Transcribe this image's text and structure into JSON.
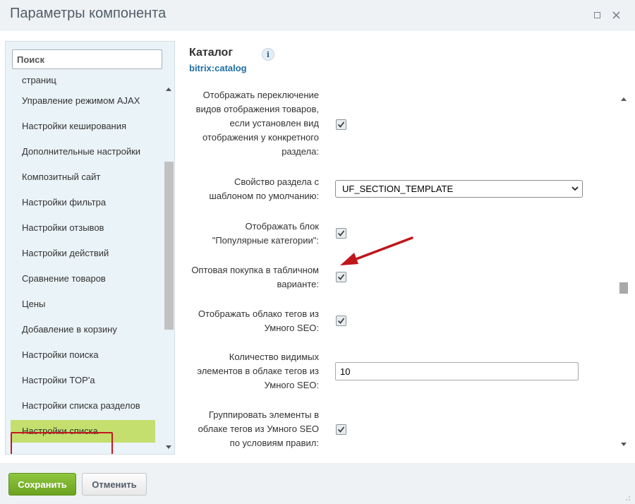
{
  "window": {
    "title": "Параметры компонента"
  },
  "component": {
    "name": "Каталог",
    "code": "bitrix:catalog",
    "info_icon": "i"
  },
  "sidebar": {
    "search_placeholder": "Поиск",
    "items": [
      {
        "label": "страниц"
      },
      {
        "label": "Управление режимом AJAX"
      },
      {
        "label": "Настройки кеширования"
      },
      {
        "label": "Дополнительные настройки"
      },
      {
        "label": "Композитный сайт"
      },
      {
        "label": "Настройки фильтра"
      },
      {
        "label": "Настройки отзывов"
      },
      {
        "label": "Настройки действий"
      },
      {
        "label": "Сравнение товаров"
      },
      {
        "label": "Цены"
      },
      {
        "label": "Добавление в корзину"
      },
      {
        "label": "Настройки поиска"
      },
      {
        "label": "Настройки TOP'а"
      },
      {
        "label": "Настройки списка разделов"
      },
      {
        "label": "Настройки списка",
        "active": true
      }
    ]
  },
  "params": {
    "view_switch": {
      "label_lines": [
        "Отображать переключение",
        "видов отображения товаров,",
        "если установлен вид",
        "отображения у конкретного",
        "раздела:"
      ],
      "checked": true
    },
    "section_template": {
      "label_lines": [
        "Свойство раздела с",
        "шаблоном по умолчанию:"
      ],
      "value": "UF_SECTION_TEMPLATE"
    },
    "popular_categories": {
      "label_lines": [
        "Отображать блок",
        "\"Популярные категории\":"
      ],
      "checked": true
    },
    "wholesale": {
      "label_lines": [
        "Оптовая покупка в табличном",
        "варианте:"
      ],
      "checked": true
    },
    "tag_cloud": {
      "label_lines": [
        "Отображать облако тегов из",
        "Умного SEO:"
      ],
      "checked": true
    },
    "tag_count": {
      "label_lines": [
        "Количество видимых",
        "элементов в облаке тегов из",
        "Умного SEO:"
      ],
      "value": "10"
    },
    "group_elements": {
      "label_lines": [
        "Группировать элементы в",
        "облаке тегов из Умного SEO",
        "по условиям правил:"
      ],
      "checked": true
    }
  },
  "footer": {
    "save_label": "Сохранить",
    "cancel_label": "Отменить"
  },
  "colors": {
    "active_item_bg": "#c4df6e",
    "highlight_outline": "#c5171e",
    "annotation_arrow": "#c0151b",
    "link_blue": "#1e6fa5",
    "save_green": "#7bb32e"
  }
}
